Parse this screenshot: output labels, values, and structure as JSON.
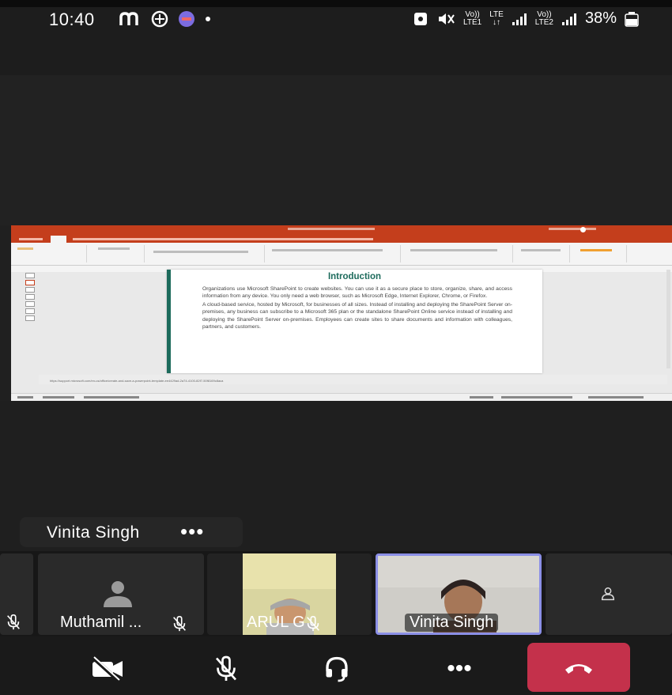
{
  "status_bar": {
    "time": "10:40",
    "carrier_1_top": "Vo))",
    "carrier_1_bottom": "LTE1",
    "lte_top": "LTE",
    "lte_bottom": "↓↑",
    "carrier_2_top": "Vo))",
    "carrier_2_bottom": "LTE2",
    "battery": "38%"
  },
  "shared_screen": {
    "slide_title": "Introduction",
    "slide_paragraph_1": "Organizations use Microsoft SharePoint to create websites. You can use it as a secure place to store, organize, share, and access information from any device. You only need a web browser, such as Microsoft Edge, Internet Explorer, Chrome, or Firefox.",
    "slide_paragraph_2": "A cloud-based service, hosted by Microsoft, for businesses of all sizes. Instead of installing and deploying the SharePoint Server on-premises, any business can subscribe to a Microsoft 365 plan or the standalone SharePoint Online service instead of installing and deploying the SharePoint Server on-premises. Employees can create sites to share documents and information with colleagues, partners, and customers.",
    "notes_text": "https://support.microsoft.com/en-us/office/create-and-save-a-powerpoint-template-ee4429ad-2a74-4100-82f7-50f8169c8aca",
    "accent_color": "#1d6b5c",
    "ribbon_color": "#c43e1c"
  },
  "active_speaker": {
    "name": "Vinita Singh",
    "more_label": "•••"
  },
  "participants": [
    {
      "name": "Muthamil ...",
      "muted": true,
      "video": false
    },
    {
      "name": "ARUL G",
      "muted": true,
      "video": true
    },
    {
      "name": "Vinita Singh",
      "muted": false,
      "video": true,
      "speaking": true
    }
  ],
  "controls": {
    "camera": "camera-off",
    "mic": "mic-off",
    "audio": "headset",
    "more": "•••",
    "end_call": "hang-up"
  },
  "colors": {
    "background": "#202020",
    "end_call": "#c4314b",
    "speaking_border": "#8b8fe6"
  }
}
